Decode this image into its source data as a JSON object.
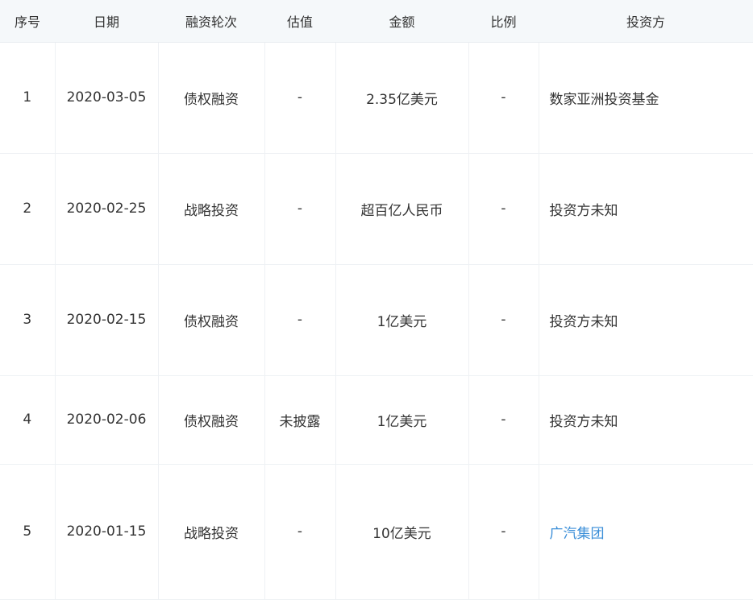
{
  "table": {
    "headers": [
      "序号",
      "日期",
      "融资轮次",
      "估值",
      "金额",
      "比例",
      "投资方"
    ],
    "rows": [
      {
        "index": "1",
        "date": "2020-03-05",
        "round": "债权融资",
        "valuation": "-",
        "amount": "2.35亿美元",
        "ratio": "-",
        "investor": "数家亚洲投资基金"
      },
      {
        "index": "2",
        "date": "2020-02-25",
        "round": "战略投资",
        "valuation": "-",
        "amount": "超百亿人民币",
        "ratio": "-",
        "investor": "投资方未知"
      },
      {
        "index": "3",
        "date": "2020-02-15",
        "round": "债权融资",
        "valuation": "-",
        "amount": "1亿美元",
        "ratio": "-",
        "investor": "投资方未知"
      },
      {
        "index": "4",
        "date": "2020-02-06",
        "round": "债权融资",
        "valuation": "未披露",
        "amount": "1亿美元",
        "ratio": "-",
        "investor": "投资方未知"
      },
      {
        "index": "5",
        "date": "2020-01-15",
        "round": "战略投资",
        "valuation": "-",
        "amount": "10亿美元",
        "ratio": "-",
        "investor": "广汽集团"
      }
    ]
  },
  "colors": {
    "header_bg": "#f5f8fa",
    "text": "#333333",
    "link": "#3a8ed8",
    "grid": "#eef1f4"
  }
}
